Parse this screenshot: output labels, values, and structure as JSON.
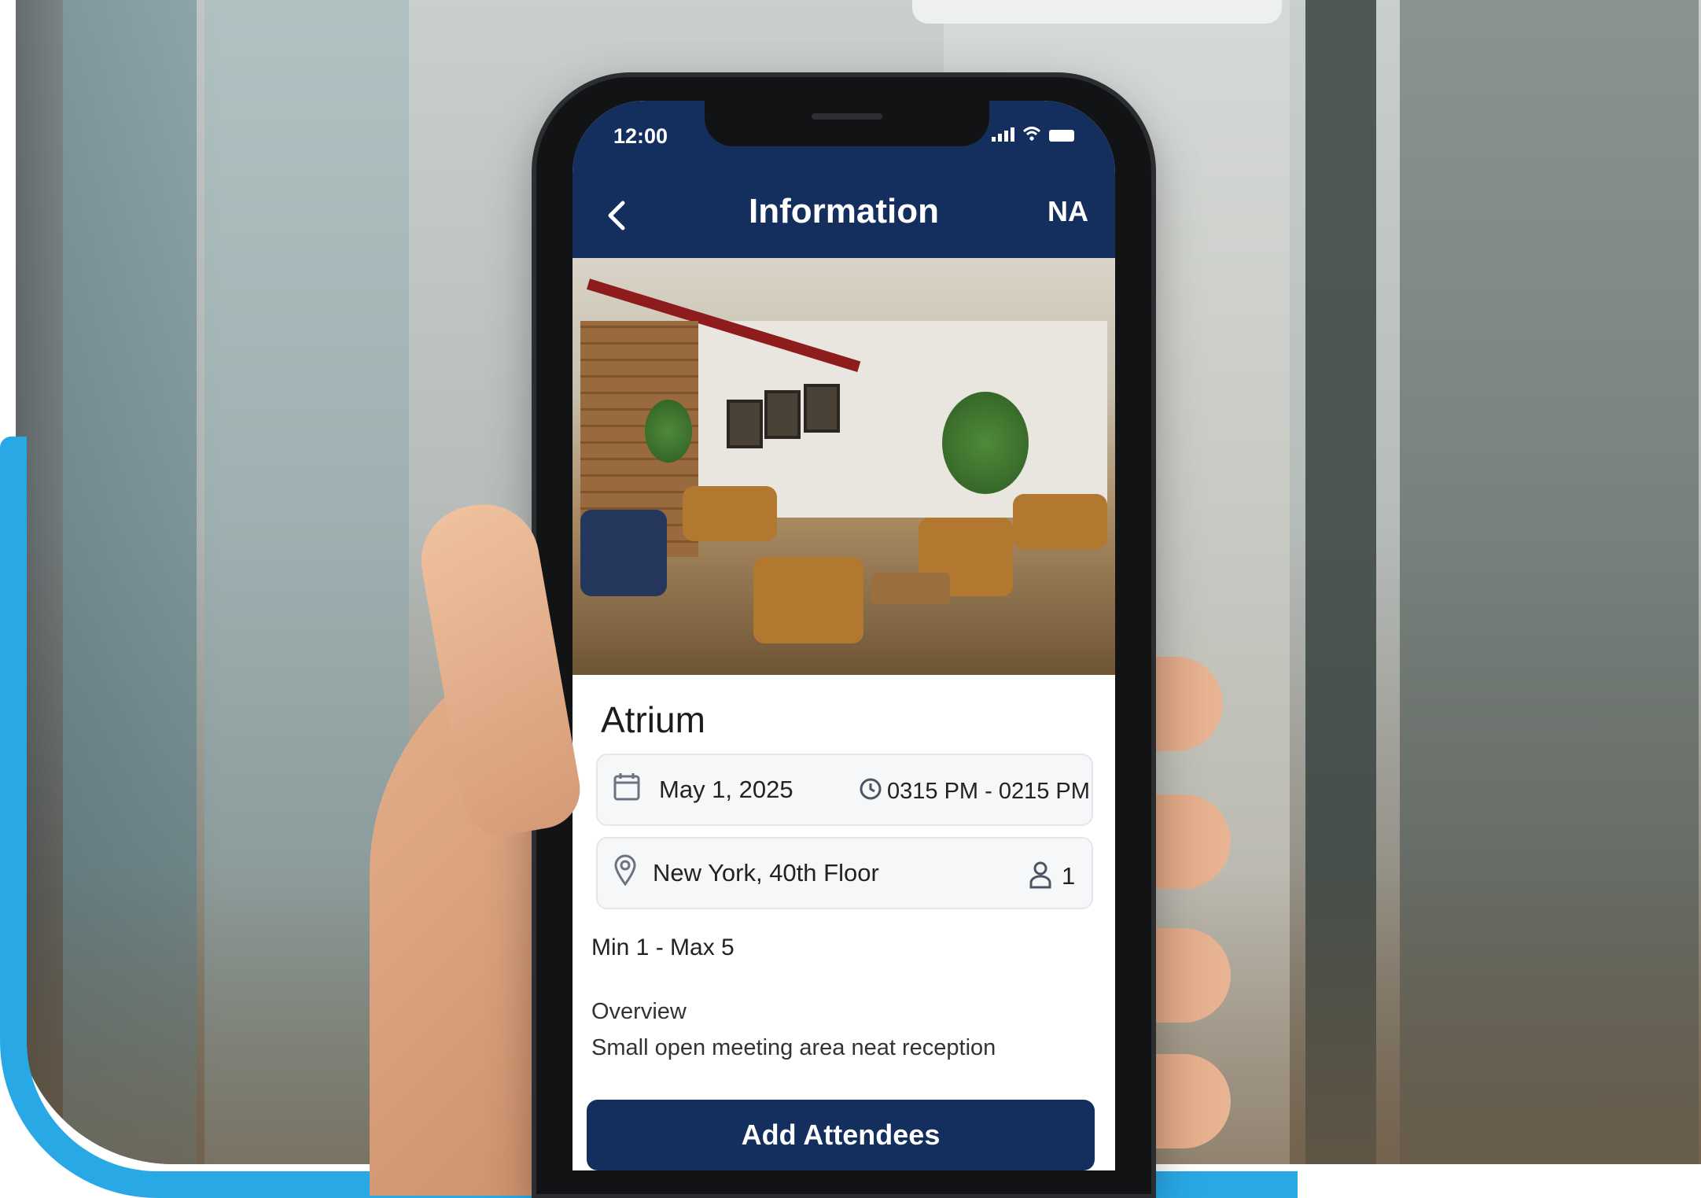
{
  "status_bar": {
    "time": "12:00",
    "icons": [
      "signal-icon",
      "wifi-icon",
      "battery-icon"
    ]
  },
  "header": {
    "back_icon": "chevron-left-icon",
    "title": "Information",
    "user_initials": "NA"
  },
  "room": {
    "name": "Atrium",
    "date": "May 1, 2025",
    "time_range": "0315 PM - 0215 PM",
    "location": "New York, 40th Floor",
    "attendee_count": "1",
    "capacity": "Min 1 - Max 5",
    "overview_label": "Overview",
    "overview_text": "Small open meeting area neat reception"
  },
  "actions": {
    "add_attendees_label": "Add Attendees"
  },
  "colors": {
    "brand_navy": "#142f5e",
    "accent_blue": "#29a8e6"
  }
}
